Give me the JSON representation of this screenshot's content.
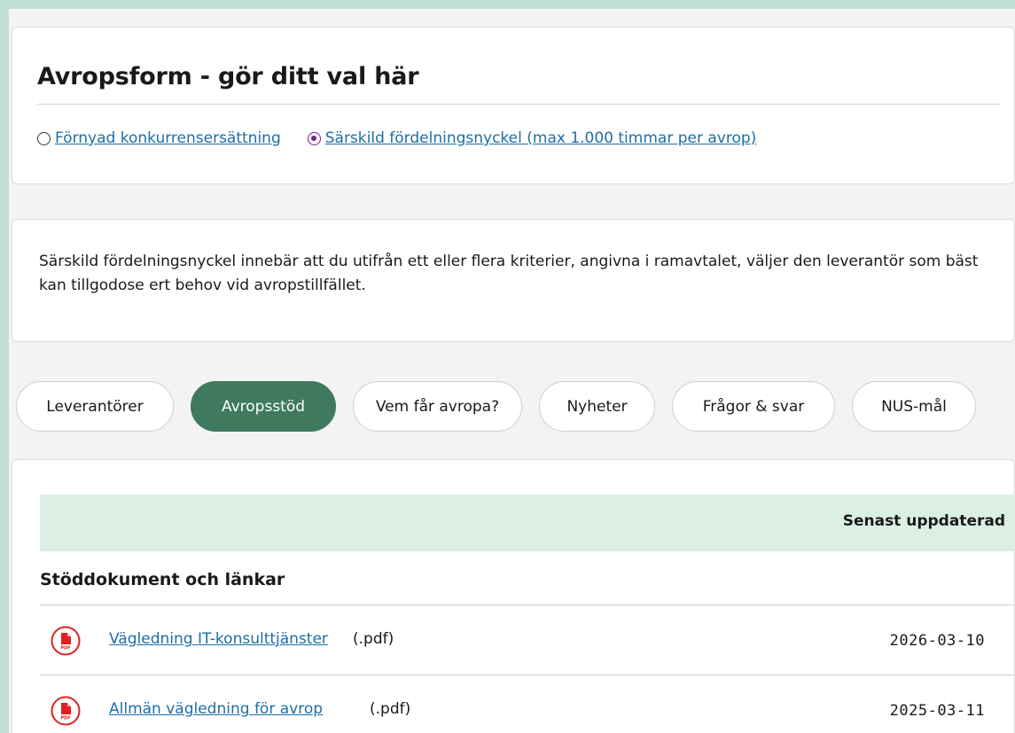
{
  "avropsform": {
    "title": "Avropsform - gör ditt val här",
    "options": [
      {
        "label": "Förnyad konkurrensersättning",
        "selected": false
      },
      {
        "label": "Särskild fördelningsnyckel (max 1.000 timmar per avrop)",
        "selected": true
      }
    ]
  },
  "description": "Särskild fördelningsnyckel innebär att du utifrån ett eller flera kriterier, angivna i ramavtalet, väljer den leverantör som bäst kan tillgodose ert behov vid avropstillfället.",
  "tabs": [
    {
      "label": "Leverantörer",
      "active": false
    },
    {
      "label": "Avropsstöd",
      "active": true
    },
    {
      "label": "Vem får avropa?",
      "active": false
    },
    {
      "label": "Nyheter",
      "active": false
    },
    {
      "label": "Frågor & svar",
      "active": false
    },
    {
      "label": "NUS-mål",
      "active": false
    }
  ],
  "table": {
    "header_updated": "Senast uppdaterad",
    "section_title": "Stöddokument och länkar",
    "rows": [
      {
        "icon": "pdf-icon",
        "link": "Vägledning IT-konsulttjänster",
        "ext": "(.pdf)",
        "date": "2026-03-10"
      },
      {
        "icon": "pdf-icon",
        "link": "Allmän vägledning för avrop",
        "ext": "(.pdf)",
        "date": "2025-03-11"
      }
    ]
  },
  "colors": {
    "accent_green": "#3f7a5f",
    "link_blue": "#1d6fa5",
    "radio_purple": "#7b1e8f",
    "pdf_red": "#e02020",
    "table_header_bg": "#dcefe5"
  }
}
